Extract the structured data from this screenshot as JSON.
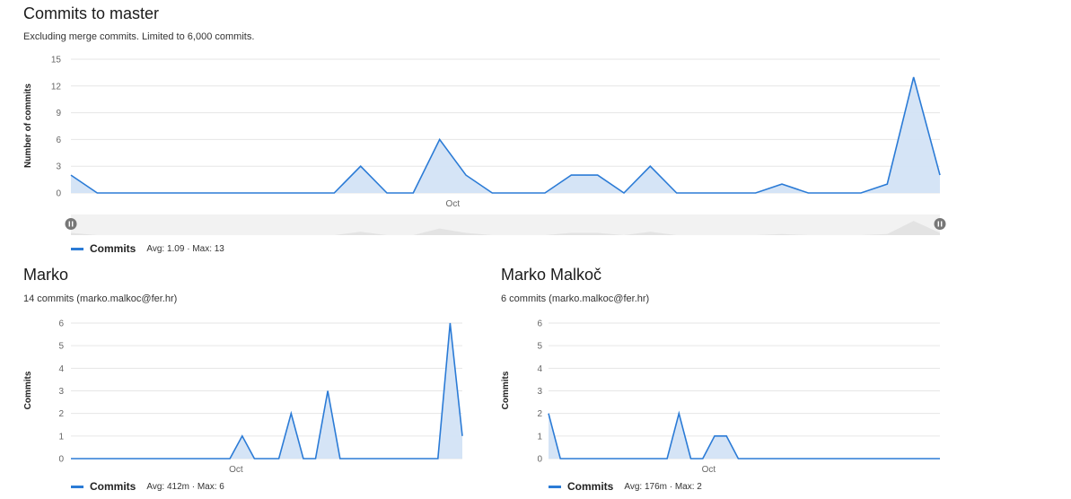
{
  "colors": {
    "line": "#2b7bd6",
    "fill": "#d3e3f6",
    "grid": "#e6e6e6",
    "navigator": "#eeeeee"
  },
  "main": {
    "title": "Commits to master",
    "subtitle": "Excluding merge commits. Limited to 6,000 commits.",
    "legend": {
      "name": "Commits",
      "stats": "Avg: 1.09 · Max: 13"
    }
  },
  "marko": {
    "title": "Marko",
    "subtitle": "14 commits (marko.malkoc@fer.hr)",
    "legend": {
      "name": "Commits",
      "stats": "Avg: 412m · Max: 6"
    }
  },
  "malkoc": {
    "title": "Marko Malkoč",
    "subtitle": "6 commits (marko.malkoc@fer.hr)",
    "legend": {
      "name": "Commits",
      "stats": "Avg: 176m · Max: 2"
    }
  },
  "chart_data": [
    {
      "type": "area",
      "ylabel": "Number of commits",
      "xlabel": "",
      "x_tick_labels": [
        "Oct"
      ],
      "x_tick_index": 14.5,
      "yticks": [
        0,
        3,
        6,
        9,
        12,
        15
      ],
      "ylim": [
        0,
        15
      ],
      "grid": true,
      "series": [
        {
          "name": "Commits",
          "values": [
            2,
            0,
            0,
            0,
            0,
            0,
            0,
            0,
            0,
            0,
            0,
            3,
            0,
            0,
            6,
            2,
            0,
            0,
            0,
            2,
            2,
            0,
            3,
            0,
            0,
            0,
            0,
            1,
            0,
            0,
            0,
            1,
            13,
            2
          ]
        }
      ]
    },
    {
      "type": "area",
      "ylabel": "Commits",
      "xlabel": "",
      "x_tick_labels": [
        "Oct"
      ],
      "x_tick_index": 13.5,
      "yticks": [
        0,
        1,
        2,
        3,
        4,
        5,
        6
      ],
      "ylim": [
        0,
        6
      ],
      "grid": true,
      "series": [
        {
          "name": "Commits",
          "values": [
            0,
            0,
            0,
            0,
            0,
            0,
            0,
            0,
            0,
            0,
            0,
            0,
            0,
            0,
            1,
            0,
            0,
            0,
            2,
            0,
            0,
            3,
            0,
            0,
            0,
            0,
            0,
            0,
            0,
            0,
            0,
            6,
            1
          ]
        }
      ]
    },
    {
      "type": "area",
      "ylabel": "Commits",
      "xlabel": "",
      "x_tick_labels": [
        "Oct"
      ],
      "x_tick_index": 13.5,
      "yticks": [
        0,
        1,
        2,
        3,
        4,
        5,
        6
      ],
      "ylim": [
        0,
        6
      ],
      "grid": true,
      "series": [
        {
          "name": "Commits",
          "values": [
            2,
            0,
            0,
            0,
            0,
            0,
            0,
            0,
            0,
            0,
            0,
            2,
            0,
            0,
            1,
            1,
            0,
            0,
            0,
            0,
            0,
            0,
            0,
            0,
            0,
            0,
            0,
            0,
            0,
            0,
            0,
            0,
            0,
            0
          ]
        }
      ]
    }
  ]
}
